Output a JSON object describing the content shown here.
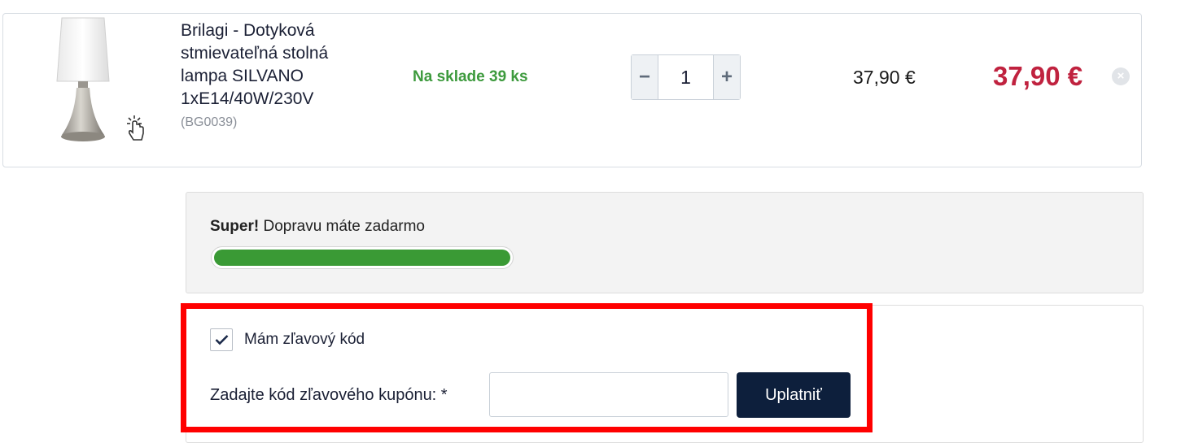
{
  "cart_item": {
    "name": "Brilagi - Dotyková stmievateľná stolná lampa SILVANO 1xE14/40W/230V",
    "sku": "(BG0039)",
    "stock": "Na sklade 39 ks",
    "quantity": "1",
    "minus_icon": "−",
    "plus_icon": "+",
    "unit_price": "37,90 €",
    "total_price": "37,90 €",
    "remove_icon": "×",
    "image_icon": "table-lamp",
    "touch_icon": "touch-hand"
  },
  "shipping": {
    "bold": "Super!",
    "text": " Dopravu máte zadarmo",
    "progress": 1.0
  },
  "coupon": {
    "checkbox_label": "Mám zľavový kód",
    "checked": true,
    "field_label": "Zadajte kód zľavového kupónu: *",
    "input_value": "",
    "apply_label": "Uplatniť"
  },
  "colors": {
    "stock_green": "#3d9a3d",
    "price_red": "#c0223f",
    "button_navy": "#0d1f3c",
    "progress_green": "#3a9a35",
    "highlight_red": "#ff0000"
  }
}
